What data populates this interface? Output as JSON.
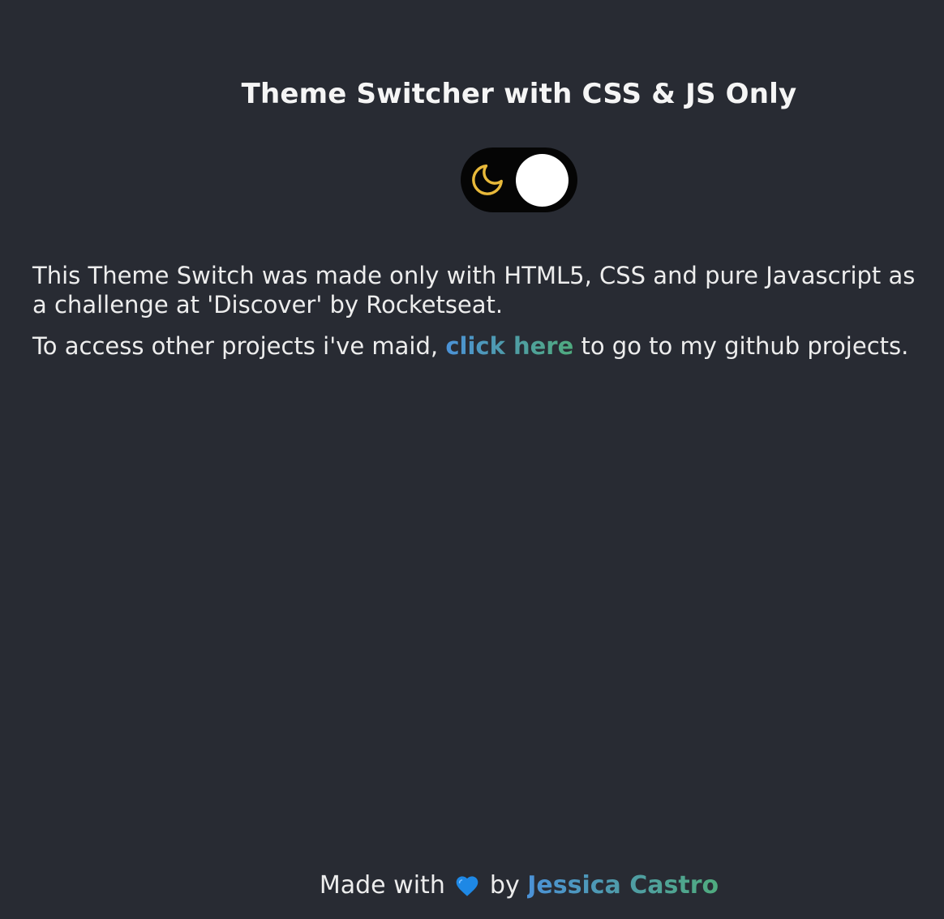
{
  "header": {
    "title": "Theme Switcher with CSS & JS Only"
  },
  "theme_toggle": {
    "icon": "moon-icon",
    "state": "dark"
  },
  "content": {
    "paragraph1": "This Theme Switch was made only with HTML5, CSS and pure Javascript as a challenge at 'Discover' by Rocketseat.",
    "paragraph2_before": "To access other projects i've maid, ",
    "paragraph2_link": "click here",
    "paragraph2_after": " to go to my github projects."
  },
  "footer": {
    "made_with": "Made with ",
    "heart_icon": "blue-heart-icon",
    "by": " by ",
    "author": "Jessica Castro"
  },
  "colors": {
    "background": "#282b33",
    "text": "#ededed",
    "link_gradient_start": "#4b92d8",
    "link_gradient_end": "#4fab7e",
    "moon": "#e8b93a",
    "toggle_track": "#050505",
    "toggle_knob": "#ffffff",
    "heart": "#1e88e5"
  }
}
